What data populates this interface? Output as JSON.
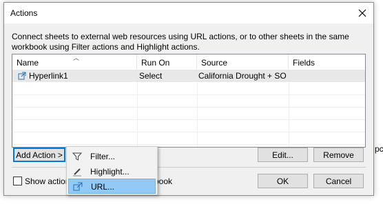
{
  "window": {
    "title": "Actions"
  },
  "description": "Connect sheets to external web resources using URL actions, or to other sheets in the same workbook using Filter actions and Highlight actions.",
  "table": {
    "columns": [
      "Name",
      "Run On",
      "Source",
      "Fields"
    ],
    "rows": [
      {
        "name": "Hyperlink1",
        "run_on": "Select",
        "source": "California Drought + SO...",
        "fields": ""
      }
    ]
  },
  "buttons": {
    "add_action": "Add Action >",
    "edit": "Edit...",
    "remove": "Remove",
    "ok": "OK",
    "cancel": "Cancel"
  },
  "checkbox": {
    "label_start": "Show actions",
    "label_end": "book",
    "checked": false
  },
  "menu": {
    "items": [
      {
        "label": "Filter...",
        "icon": "filter-icon"
      },
      {
        "label": "Highlight...",
        "icon": "highlight-icon"
      },
      {
        "label": "URL...",
        "icon": "link-icon"
      }
    ],
    "highlighted": "URL..."
  },
  "background_text": "pc",
  "colors": {
    "menu_highlight": "#91c9f7",
    "focus_border": "#0078d7"
  }
}
